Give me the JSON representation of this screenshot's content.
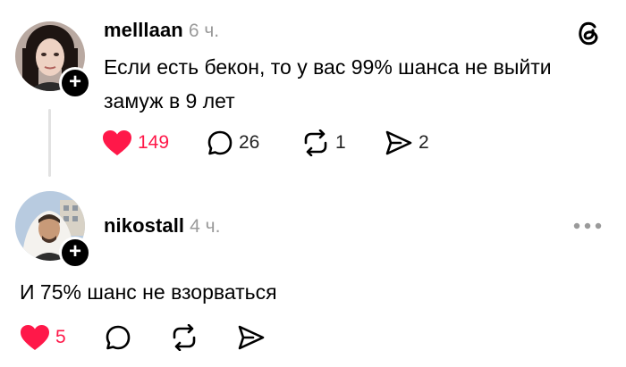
{
  "posts": [
    {
      "username": "melllaan",
      "time": "6 ч.",
      "text_line1": "Если есть бекон, то у вас 99% шанса не выйти",
      "text_line2": "замуж в 9 лет",
      "likes": "149",
      "replies": "26",
      "reposts": "1",
      "shares": "2",
      "liked": true
    },
    {
      "username": "nikostall",
      "time": "4 ч.",
      "text": "И 75% шанс не взорваться",
      "likes": "5",
      "liked": true
    }
  ],
  "icons": {
    "brand": "threads-logo-icon",
    "like": "heart-icon",
    "reply": "comment-bubble-icon",
    "repost": "repost-icon",
    "share": "send-icon",
    "more": "more-dots-icon",
    "follow": "plus-icon"
  },
  "colors": {
    "like": "#ff1849",
    "muted": "#9a9a9a",
    "thread_line": "#e2e2e2"
  }
}
